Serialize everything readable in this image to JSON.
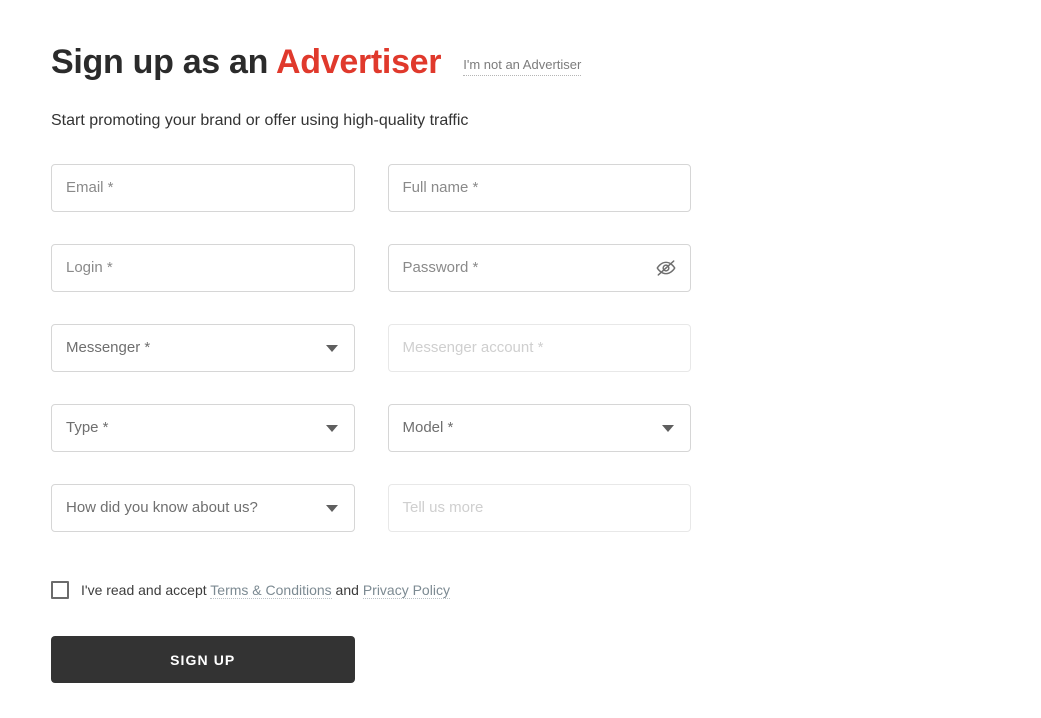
{
  "header": {
    "title_prefix": "Sign up as an ",
    "title_accent": "Advertiser",
    "switch_link": "I'm not an Advertiser",
    "subtitle": "Start promoting your brand or offer using high-quality traffic"
  },
  "colors": {
    "accent_red": "#e0392c",
    "button_dark": "#333333",
    "border": "#d6d6d6",
    "border_disabled": "#e8e8e8",
    "placeholder": "#8a8a8a",
    "placeholder_disabled": "#cfcfcf",
    "link_gray": "#7c8a92"
  },
  "form": {
    "rows": [
      {
        "left": {
          "name": "email",
          "label": "Email *",
          "kind": "text",
          "disabled": false
        },
        "right": {
          "name": "full-name",
          "label": "Full name *",
          "kind": "text",
          "disabled": false
        }
      },
      {
        "left": {
          "name": "login",
          "label": "Login *",
          "kind": "text",
          "disabled": false
        },
        "right": {
          "name": "password",
          "label": "Password *",
          "kind": "password",
          "disabled": false,
          "icon": "eye-off-icon"
        }
      },
      {
        "left": {
          "name": "messenger",
          "label": "Messenger *",
          "kind": "select",
          "disabled": false
        },
        "right": {
          "name": "messenger-account",
          "label": "Messenger account *",
          "kind": "text",
          "disabled": true
        }
      },
      {
        "left": {
          "name": "type",
          "label": "Type *",
          "kind": "select",
          "disabled": false
        },
        "right": {
          "name": "model",
          "label": "Model *",
          "kind": "select",
          "disabled": false
        }
      },
      {
        "left": {
          "name": "referral-source",
          "label": "How did you know about us?",
          "kind": "select",
          "disabled": false
        },
        "right": {
          "name": "tell-us-more",
          "label": "Tell us more",
          "kind": "text",
          "disabled": true
        }
      }
    ]
  },
  "terms": {
    "checkbox_checked": false,
    "text_before": "I've read and accept ",
    "link_terms": "Terms & Conditions",
    "text_between": " and ",
    "link_privacy": "Privacy Policy"
  },
  "submit": {
    "label": "SIGN UP"
  }
}
